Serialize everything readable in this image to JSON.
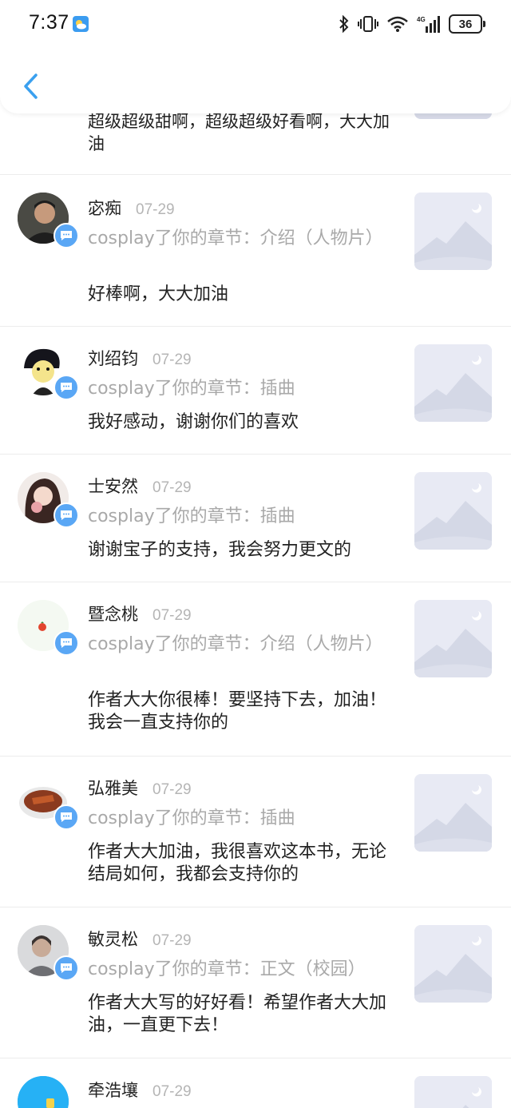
{
  "status_bar": {
    "time": "7:37",
    "battery": "36"
  },
  "partial": {
    "reply": "超级超级甜啊，超级超级好看啊，大大加油"
  },
  "items": [
    {
      "name": "宓痴",
      "date": "07-29",
      "action": "cosplay了你的章节：介绍（人物片）",
      "reply": "好棒啊，大大加油"
    },
    {
      "name": "刘绍钧",
      "date": "07-29",
      "action": "cosplay了你的章节：插曲",
      "reply": "我好感动，谢谢你们的喜欢"
    },
    {
      "name": "士安然",
      "date": "07-29",
      "action": "cosplay了你的章节：插曲",
      "reply": "谢谢宝子的支持，我会努力更文的"
    },
    {
      "name": "暨念桃",
      "date": "07-29",
      "action": "cosplay了你的章节：介绍（人物片）",
      "reply": "作者大大你很棒！要坚持下去，加油！我会一直支持你的"
    },
    {
      "name": "弘雅美",
      "date": "07-29",
      "action": "cosplay了你的章节：插曲",
      "reply": "作者大大加油，我很喜欢这本书，无论结局如何，我都会支持你的"
    },
    {
      "name": "敏灵松",
      "date": "07-29",
      "action": "cosplay了你的章节：正文（校园）",
      "reply": "作者大大写的好好看！希望作者大大加油，一直更下去！"
    },
    {
      "name": "牵浩壤",
      "date": "07-29",
      "action": "",
      "reply": ""
    }
  ],
  "colors": {
    "accent": "#3aa0ef",
    "badge": "#5aa7f5",
    "muted": "#a9a9a9"
  }
}
